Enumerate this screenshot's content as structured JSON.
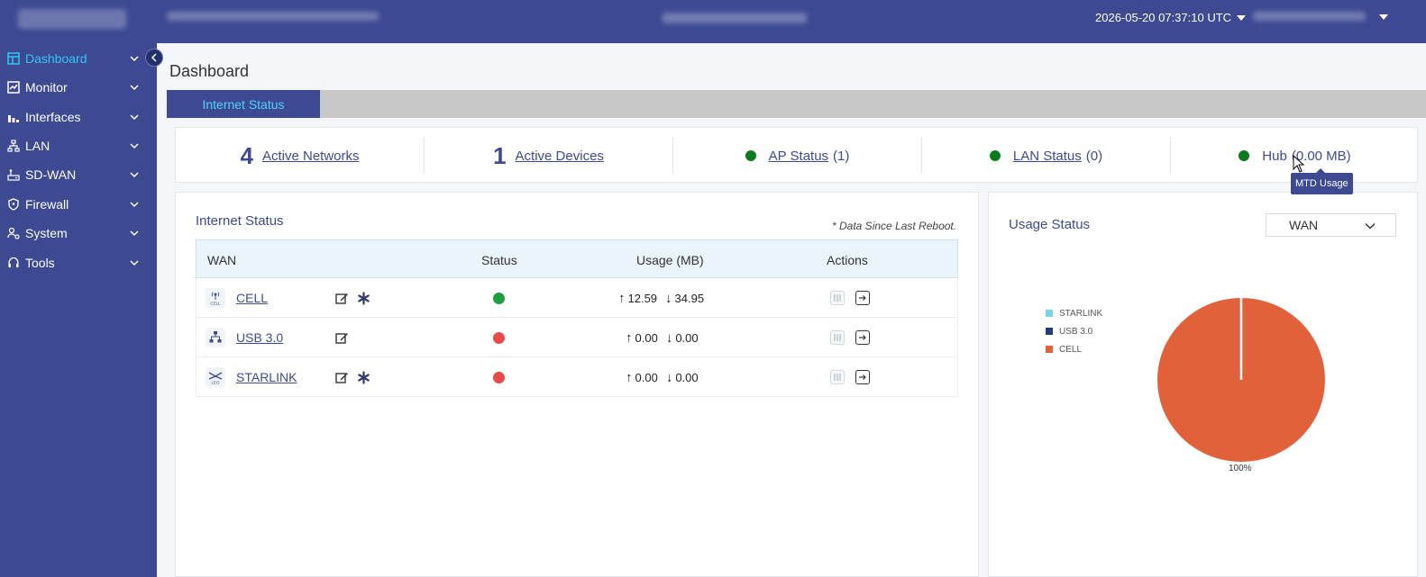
{
  "topbar": {
    "datetime": "2026-05-20 07:37:10 UTC"
  },
  "sidebar": {
    "items": [
      {
        "label": "Dashboard",
        "icon": "dashboard-icon"
      },
      {
        "label": "Monitor",
        "icon": "monitor-icon"
      },
      {
        "label": "Interfaces",
        "icon": "bar-chart-icon"
      },
      {
        "label": "LAN",
        "icon": "lan-icon"
      },
      {
        "label": "SD-WAN",
        "icon": "sdwan-icon"
      },
      {
        "label": "Firewall",
        "icon": "shield-icon"
      },
      {
        "label": "System",
        "icon": "system-icon"
      },
      {
        "label": "Tools",
        "icon": "headset-icon"
      }
    ],
    "active_color": "#33c6f4"
  },
  "page": {
    "title": "Dashboard",
    "tab": "Internet Status"
  },
  "summary": {
    "active_networks_count": "4",
    "active_networks_label": "Active Networks",
    "active_devices_count": "1",
    "active_devices_label": "Active Devices",
    "ap_status_label": "AP Status",
    "ap_status_value": "(1)",
    "lan_status_label": "LAN Status",
    "lan_status_value": "(0)",
    "hub_label": "Hub",
    "hub_value": "(0.00 MB)",
    "tooltip": "MTD Usage"
  },
  "internet_status": {
    "title": "Internet Status",
    "note": "* Data Since Last Reboot.",
    "columns": {
      "wan": "WAN",
      "status": "Status",
      "usage": "Usage (MB)",
      "actions": "Actions"
    },
    "rows": [
      {
        "name": "CELL",
        "icon": "cell-tower-icon",
        "icon_text": "CELL",
        "status": "green",
        "up": "12.59",
        "down": "34.95",
        "has_asterisk": true
      },
      {
        "name": "USB 3.0",
        "icon": "network-icon",
        "icon_text": "",
        "status": "red",
        "up": "0.00",
        "down": "0.00",
        "has_asterisk": false
      },
      {
        "name": "STARLINK",
        "icon": "satellite-icon",
        "icon_text": "LEO",
        "status": "red",
        "up": "0.00",
        "down": "0.00",
        "has_asterisk": true
      }
    ]
  },
  "usage_status": {
    "title": "Usage Status",
    "select_value": "WAN",
    "legend": [
      {
        "label": "STARLINK",
        "color": "#7fd3e0"
      },
      {
        "label": "USB 3.0",
        "color": "#1f3f7a"
      },
      {
        "label": "CELL",
        "color": "#e0613a"
      }
    ],
    "pie_label": "100%"
  }
}
